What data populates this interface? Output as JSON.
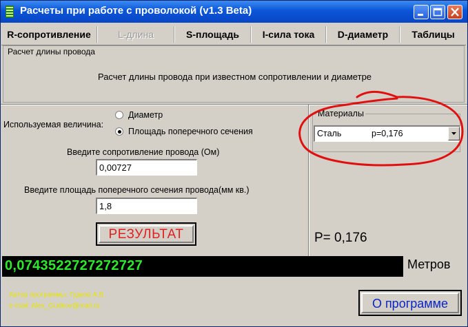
{
  "window": {
    "title": "Расчеты при работе с проволокой (v1.3 Beta)"
  },
  "tabs": [
    {
      "label": "R-сопротивление",
      "enabled": true
    },
    {
      "label": "L-длина",
      "enabled": false
    },
    {
      "label": "S-площадь",
      "enabled": true
    },
    {
      "label": "I-сила тока",
      "enabled": true
    },
    {
      "label": "D-диаметр",
      "enabled": true
    },
    {
      "label": "Таблицы",
      "enabled": true
    }
  ],
  "section": {
    "title": "Расчет длины провода",
    "description": "Расчет длины провода при известном сопротивлении и диаметре"
  },
  "form": {
    "quantity_label": "Используемая величина:",
    "options": [
      {
        "label": "Диаметр",
        "selected": false
      },
      {
        "label": "Площадь поперечного сечения",
        "selected": true
      }
    ],
    "resistance_label": "Введите сопротивление провода (Ом)",
    "resistance_value": "0,00727",
    "area_label": "Введите площадь поперечного сечения провода(мм кв.)",
    "area_value": "1,8",
    "result_button": "РЕЗУЛЬТАТ"
  },
  "materials": {
    "title": "Материалы",
    "selected_name": "Сталь",
    "selected_rho": "p=0,176",
    "p_value": "P= 0,176"
  },
  "output": {
    "value": "0,0743522727272727",
    "units": "Метров"
  },
  "footer": {
    "author_line": "Автор программы: Гудков А.В.",
    "email_line": "e-mail: Alex_Gudkov@mail.ru",
    "about_button": "О программе"
  },
  "colors": {
    "title_bar": "#0b55d8",
    "output_text": "#2ee82e",
    "result_text": "#e02020",
    "about_text": "#0b24c8",
    "annotation": "#e01010",
    "author_text": "#e6e600"
  },
  "icons": {
    "app": "wire-coil-icon",
    "minimize": "minimize-icon",
    "maximize": "maximize-icon",
    "close": "close-icon",
    "dropdown": "chevron-down-icon"
  }
}
